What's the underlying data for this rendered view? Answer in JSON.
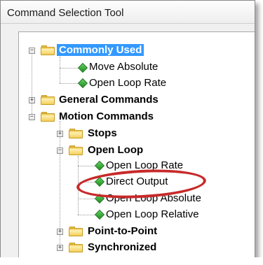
{
  "window": {
    "title": "Command Selection Tool"
  },
  "tree": {
    "commonly_used": "Commonly Used",
    "move_absolute": "Move Absolute",
    "open_loop_rate_1": "Open Loop Rate",
    "general_commands": "General Commands",
    "motion_commands": "Motion Commands",
    "stops": "Stops",
    "open_loop": "Open Loop",
    "open_loop_rate_2": "Open Loop Rate",
    "direct_output": "Direct Output",
    "open_loop_absolute": "Open Loop Absolute",
    "open_loop_relative": "Open Loop Relative",
    "point_to_point": "Point-to-Point",
    "synchronized": "Synchronized"
  },
  "colors": {
    "selection": "#3399ff",
    "highlight_ring": "#c72a2a",
    "command_icon": "#2a9d2a",
    "folder_icon": "#f0c94a"
  },
  "icons": {
    "expand": "plus-box-icon",
    "collapse": "minus-box-icon",
    "folder": "folder-icon",
    "command": "green-diamond-icon"
  }
}
